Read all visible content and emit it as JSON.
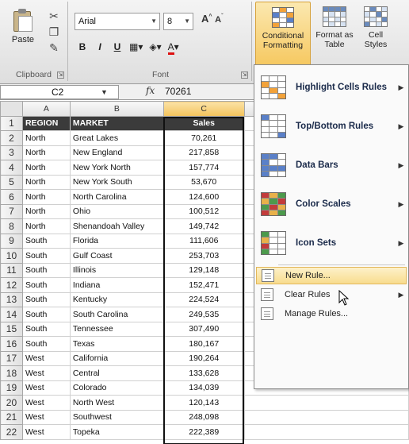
{
  "ribbon": {
    "clipboard": {
      "paste_label": "Paste",
      "group_label": "Clipboard",
      "launcher": "⇲"
    },
    "font": {
      "font_name": "Arial",
      "font_size": "8",
      "grow": "A",
      "shrink": "A",
      "bold": "B",
      "italic": "I",
      "underline": "U",
      "group_label": "Font",
      "launcher": "⇲"
    },
    "styles": {
      "conditional_formatting_label": "Conditional Formatting",
      "format_as_table_label": "Format as Table",
      "cell_styles_label": "Cell Styles"
    }
  },
  "formula_bar": {
    "name_box": "C2",
    "fx": "fx",
    "value": "70261"
  },
  "sheet": {
    "columns": [
      "A",
      "B",
      "C"
    ],
    "headers": [
      "REGION",
      "MARKET",
      "Sales"
    ],
    "rows": [
      {
        "num": "2",
        "region": "North",
        "market": "Great Lakes",
        "sales": "70,261"
      },
      {
        "num": "3",
        "region": "North",
        "market": "New England",
        "sales": "217,858"
      },
      {
        "num": "4",
        "region": "North",
        "market": "New York North",
        "sales": "157,774"
      },
      {
        "num": "5",
        "region": "North",
        "market": "New York South",
        "sales": "53,670"
      },
      {
        "num": "6",
        "region": "North",
        "market": "North Carolina",
        "sales": "124,600"
      },
      {
        "num": "7",
        "region": "North",
        "market": "Ohio",
        "sales": "100,512"
      },
      {
        "num": "8",
        "region": "North",
        "market": "Shenandoah Valley",
        "sales": "149,742"
      },
      {
        "num": "9",
        "region": "South",
        "market": "Florida",
        "sales": "111,606"
      },
      {
        "num": "10",
        "region": "South",
        "market": "Gulf Coast",
        "sales": "253,703"
      },
      {
        "num": "11",
        "region": "South",
        "market": "Illinois",
        "sales": "129,148"
      },
      {
        "num": "12",
        "region": "South",
        "market": "Indiana",
        "sales": "152,471"
      },
      {
        "num": "13",
        "region": "South",
        "market": "Kentucky",
        "sales": "224,524"
      },
      {
        "num": "14",
        "region": "South",
        "market": "South Carolina",
        "sales": "249,535"
      },
      {
        "num": "15",
        "region": "South",
        "market": "Tennessee",
        "sales": "307,490"
      },
      {
        "num": "16",
        "region": "South",
        "market": "Texas",
        "sales": "180,167"
      },
      {
        "num": "17",
        "region": "West",
        "market": "California",
        "sales": "190,264"
      },
      {
        "num": "18",
        "region": "West",
        "market": "Central",
        "sales": "133,628"
      },
      {
        "num": "19",
        "region": "West",
        "market": "Colorado",
        "sales": "134,039"
      },
      {
        "num": "20",
        "region": "West",
        "market": "North West",
        "sales": "120,143"
      },
      {
        "num": "21",
        "region": "West",
        "market": "Southwest",
        "sales": "248,098"
      },
      {
        "num": "22",
        "region": "West",
        "market": "Topeka",
        "sales": "222,389"
      }
    ]
  },
  "menu": {
    "items": [
      {
        "label": "Highlight Cells Rules",
        "icon": "highlight-cells-icon"
      },
      {
        "label": "Top/Bottom Rules",
        "icon": "top-bottom-icon"
      },
      {
        "label": "Data Bars",
        "icon": "data-bars-icon"
      },
      {
        "label": "Color Scales",
        "icon": "color-scales-icon"
      },
      {
        "label": "Icon Sets",
        "icon": "icon-sets-icon"
      }
    ],
    "small_items": [
      {
        "label": "New Rule...",
        "icon": "new-rule-icon",
        "hover": true
      },
      {
        "label": "Clear Rules",
        "icon": "clear-rules-icon",
        "hover": false
      },
      {
        "label": "Manage Rules...",
        "icon": "manage-rules-icon",
        "hover": false
      }
    ]
  }
}
